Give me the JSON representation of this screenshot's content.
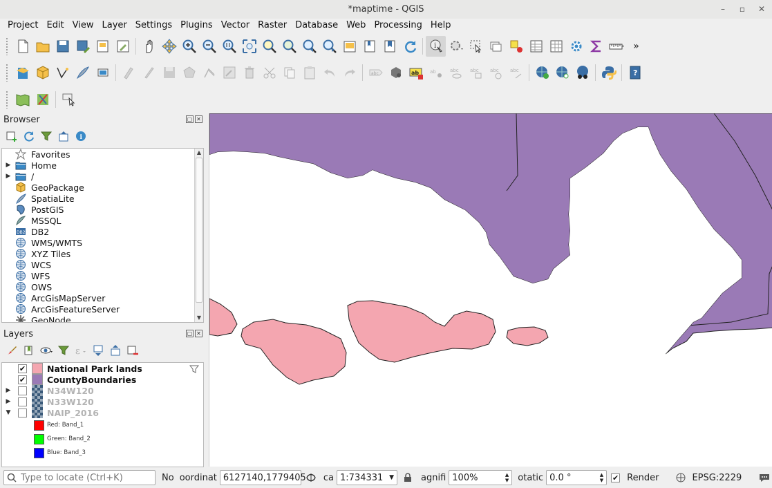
{
  "window": {
    "title": "*maptime - QGIS",
    "minimize": "–",
    "restore": "▫",
    "close": "✕"
  },
  "menu": [
    "Project",
    "Edit",
    "View",
    "Layer",
    "Settings",
    "Plugins",
    "Vector",
    "Raster",
    "Database",
    "Web",
    "Processing",
    "Help"
  ],
  "toolbar": {
    "overflow": "»",
    "label_abc": "abc",
    "label_ab": "ab"
  },
  "browser": {
    "title": "Browser",
    "items": [
      {
        "label": "Favorites",
        "icon": "star-icon",
        "expand": ""
      },
      {
        "label": "Home",
        "icon": "folder-icon",
        "expand": "▶"
      },
      {
        "label": "/",
        "icon": "folder-icon",
        "expand": "▶"
      },
      {
        "label": "GeoPackage",
        "icon": "geopackage-icon",
        "expand": ""
      },
      {
        "label": "SpatiaLite",
        "icon": "spatialite-icon",
        "expand": ""
      },
      {
        "label": "PostGIS",
        "icon": "postgis-icon",
        "expand": ""
      },
      {
        "label": "MSSQL",
        "icon": "mssql-icon",
        "expand": ""
      },
      {
        "label": "DB2",
        "icon": "db2-icon",
        "expand": ""
      },
      {
        "label": "WMS/WMTS",
        "icon": "globe-icon",
        "expand": ""
      },
      {
        "label": "XYZ Tiles",
        "icon": "globe-icon",
        "expand": ""
      },
      {
        "label": "WCS",
        "icon": "globe-icon",
        "expand": ""
      },
      {
        "label": "WFS",
        "icon": "globe-icon",
        "expand": ""
      },
      {
        "label": "OWS",
        "icon": "globe-icon",
        "expand": ""
      },
      {
        "label": "ArcGisMapServer",
        "icon": "globe-icon",
        "expand": ""
      },
      {
        "label": "ArcGisFeatureServer",
        "icon": "globe-icon",
        "expand": ""
      },
      {
        "label": "GeoNode",
        "icon": "geonode-icon",
        "expand": ""
      }
    ],
    "db2_badge": "DB2"
  },
  "layers": {
    "title": "Layers",
    "items": [
      {
        "name": "National Park lands",
        "checked": true,
        "expand": "",
        "style": "vector",
        "color": "#f4a6b0",
        "enabled": true
      },
      {
        "name": "CountyBoundaries",
        "checked": true,
        "expand": "",
        "style": "vector",
        "color": "#9a7ab6",
        "enabled": true
      },
      {
        "name": "N34W120",
        "checked": false,
        "expand": "▶",
        "style": "raster",
        "enabled": false
      },
      {
        "name": "N33W120",
        "checked": false,
        "expand": "▶",
        "style": "raster",
        "enabled": false
      },
      {
        "name": "NAIP_2016",
        "checked": false,
        "expand": "▼",
        "style": "raster",
        "enabled": false
      }
    ],
    "bands": [
      {
        "label": "Red:  Band_1",
        "color": "#ff0000"
      },
      {
        "label": "Green: Band_2",
        "color": "#00ff00"
      },
      {
        "label": "Blue:  Band_3",
        "color": "#0000ff"
      }
    ],
    "check_mark": "✔"
  },
  "map": {
    "county_color": "#9a7ab6",
    "park_color": "#f4a6b0",
    "background": "#ffffff"
  },
  "status": {
    "locate_placeholder": "Type to locate (Ctrl+K)",
    "no_label": "No",
    "coord_label": "oordinat",
    "coord_value": "6127140,1779405",
    "scale_label": "ca",
    "scale_value": "1:734331",
    "mag_label": "agnifi",
    "mag_value": "100%",
    "rot_label": "otatic",
    "rot_value": "0.0 °",
    "render_label": "Render",
    "render_checked": "✔",
    "crs": "EPSG:2229"
  }
}
